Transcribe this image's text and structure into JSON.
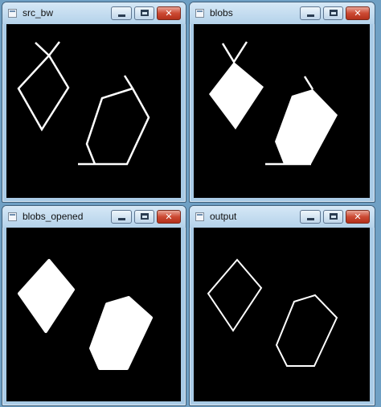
{
  "windows": [
    {
      "id": "src_bw",
      "title": "src_bw"
    },
    {
      "id": "blobs",
      "title": "blobs"
    },
    {
      "id": "blobs_opened",
      "title": "blobs_opened"
    },
    {
      "id": "output",
      "title": "output"
    }
  ],
  "window_buttons": {
    "minimize": "minimize-icon",
    "maximize": "maximize-icon",
    "close": "✕"
  },
  "colors": {
    "desktop": "#6fa0c4",
    "frame": "#a9cbe6",
    "canvas_background": "#000000",
    "foreground": "#ffffff",
    "close_button": "#cc4a33"
  }
}
